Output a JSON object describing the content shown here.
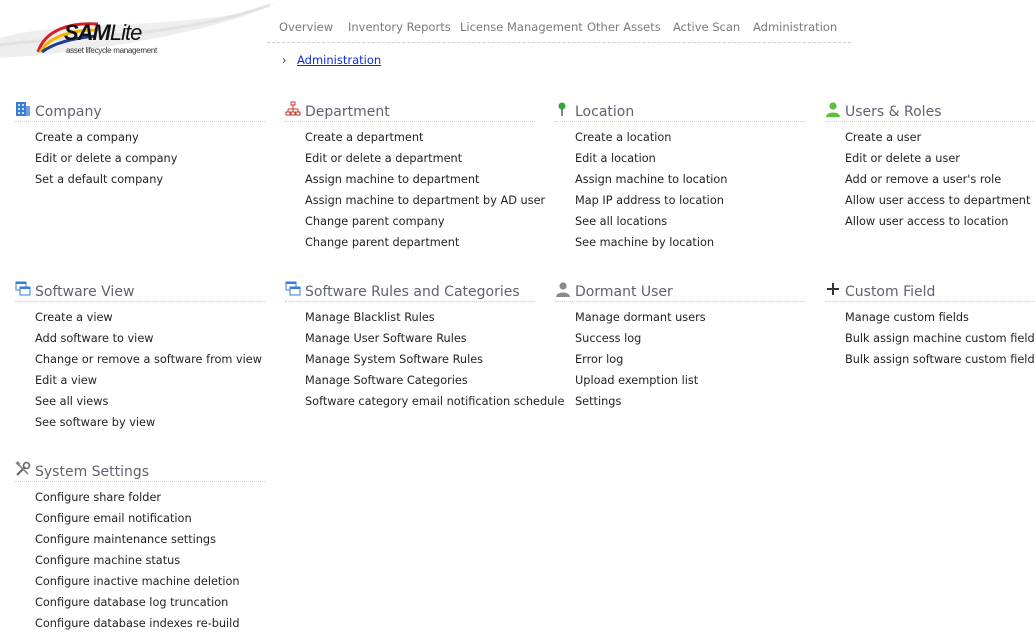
{
  "logo": {
    "name_bold": "SAM",
    "name_light": "Lite",
    "tagline": "asset lifecycle management"
  },
  "nav": [
    "Overview",
    "Inventory Reports",
    "License Management",
    "Other Assets",
    "Active Scan",
    "Administration"
  ],
  "breadcrumb": {
    "current": "Administration"
  },
  "sections": {
    "company": {
      "title": "Company",
      "icon": "building-icon",
      "links": [
        "Create a company",
        "Edit or delete a company",
        "Set a default company"
      ]
    },
    "department": {
      "title": "Department",
      "icon": "org-chart-icon",
      "links": [
        "Create a department",
        "Edit or delete a department",
        "Assign machine to department",
        "Assign machine to department by AD user",
        "Change parent company",
        "Change parent department"
      ]
    },
    "location": {
      "title": "Location",
      "icon": "map-pin-icon",
      "links": [
        "Create a location",
        "Edit a location",
        "Assign machine to location",
        "Map IP address to location",
        "See all locations",
        "See machine by location"
      ]
    },
    "users_roles": {
      "title": "Users & Roles",
      "icon": "user-icon",
      "links": [
        "Create a user",
        "Edit or delete a user",
        "Add or remove a user's role",
        "Allow user access to department",
        "Allow user access to location"
      ]
    },
    "software_view": {
      "title": "Software View",
      "icon": "windows-stack-icon",
      "links": [
        "Create a view",
        "Add software to view",
        "Change or remove a software from view",
        "Edit a view",
        "See all views",
        "See software by view"
      ]
    },
    "software_rules": {
      "title": "Software Rules and Categories",
      "icon": "windows-stack-icon",
      "links": [
        "Manage Blacklist Rules",
        "Manage User Software Rules",
        "Manage System Software Rules",
        "Manage Software Categories",
        "Software category email notification schedule"
      ]
    },
    "dormant_user": {
      "title": "Dormant User",
      "icon": "user-gray-icon",
      "links": [
        "Manage dormant users",
        "Success log",
        "Error log",
        "Upload exemption list",
        "Settings"
      ]
    },
    "custom_field": {
      "title": "Custom Field",
      "icon": "plus-icon",
      "links": [
        "Manage custom fields",
        "Bulk assign machine custom field",
        "Bulk assign software custom field"
      ]
    },
    "system_settings": {
      "title": "System Settings",
      "icon": "tools-icon",
      "links": [
        "Configure share folder",
        "Configure email notification",
        "Configure maintenance settings",
        "Configure machine status",
        "Configure inactive machine deletion",
        "Configure database log truncation",
        "Configure database indexes re-build"
      ]
    }
  },
  "colors": {
    "link": "#0a2bd9",
    "section_title": "#5f6370",
    "nav": "#7a7a7a"
  }
}
